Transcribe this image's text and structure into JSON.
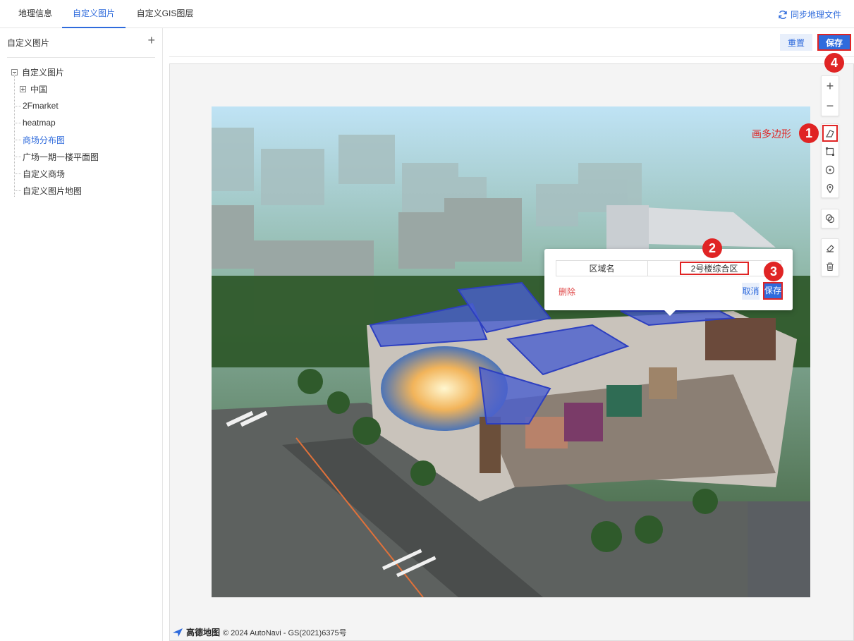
{
  "tabs": [
    {
      "label": "地理信息",
      "active": false
    },
    {
      "label": "自定义图片",
      "active": true
    },
    {
      "label": "自定义GIS图层",
      "active": false
    }
  ],
  "sync_label": "同步地理文件",
  "left_panel": {
    "title": "自定义图片",
    "tree": {
      "root": "自定义图片",
      "items": [
        {
          "label": "中国",
          "expandable": true,
          "selected": false
        },
        {
          "label": "2Fmarket",
          "expandable": false,
          "selected": false
        },
        {
          "label": "heatmap",
          "expandable": false,
          "selected": false
        },
        {
          "label": "商场分布图",
          "expandable": false,
          "selected": true
        },
        {
          "label": "广场一期一楼平面图",
          "expandable": false,
          "selected": false
        },
        {
          "label": "自定义商场",
          "expandable": false,
          "selected": false
        },
        {
          "label": "自定义图片地图",
          "expandable": false,
          "selected": false
        }
      ]
    }
  },
  "toolbar": {
    "reset_label": "重置",
    "save_label": "保存"
  },
  "popup": {
    "field_label": "区域名",
    "field_value": "2号楼综合区",
    "delete_label": "删除",
    "cancel_label": "取消",
    "save_label": "保存"
  },
  "map_tools": {
    "zoom_in": "zoom-in-icon",
    "zoom_out": "zoom-out-icon",
    "draw_tools": [
      "draw-polygon-icon",
      "draw-rectangle-icon",
      "draw-circle-icon",
      "place-marker-icon"
    ],
    "overlap": "overlap-icon",
    "edit_tools": [
      "eraser-icon",
      "trash-icon"
    ]
  },
  "annotations": {
    "step1": "1",
    "step2": "2",
    "step3": "3",
    "step4": "4",
    "draw_polygon_label": "画多边形"
  },
  "attribution": {
    "logo": "高德地图",
    "text": "© 2024 AutoNavi - GS(2021)6375号"
  },
  "colors": {
    "accent": "#2f6bdc",
    "annotation_red": "#e02424",
    "polygon_fill": "#4a5fd0"
  }
}
